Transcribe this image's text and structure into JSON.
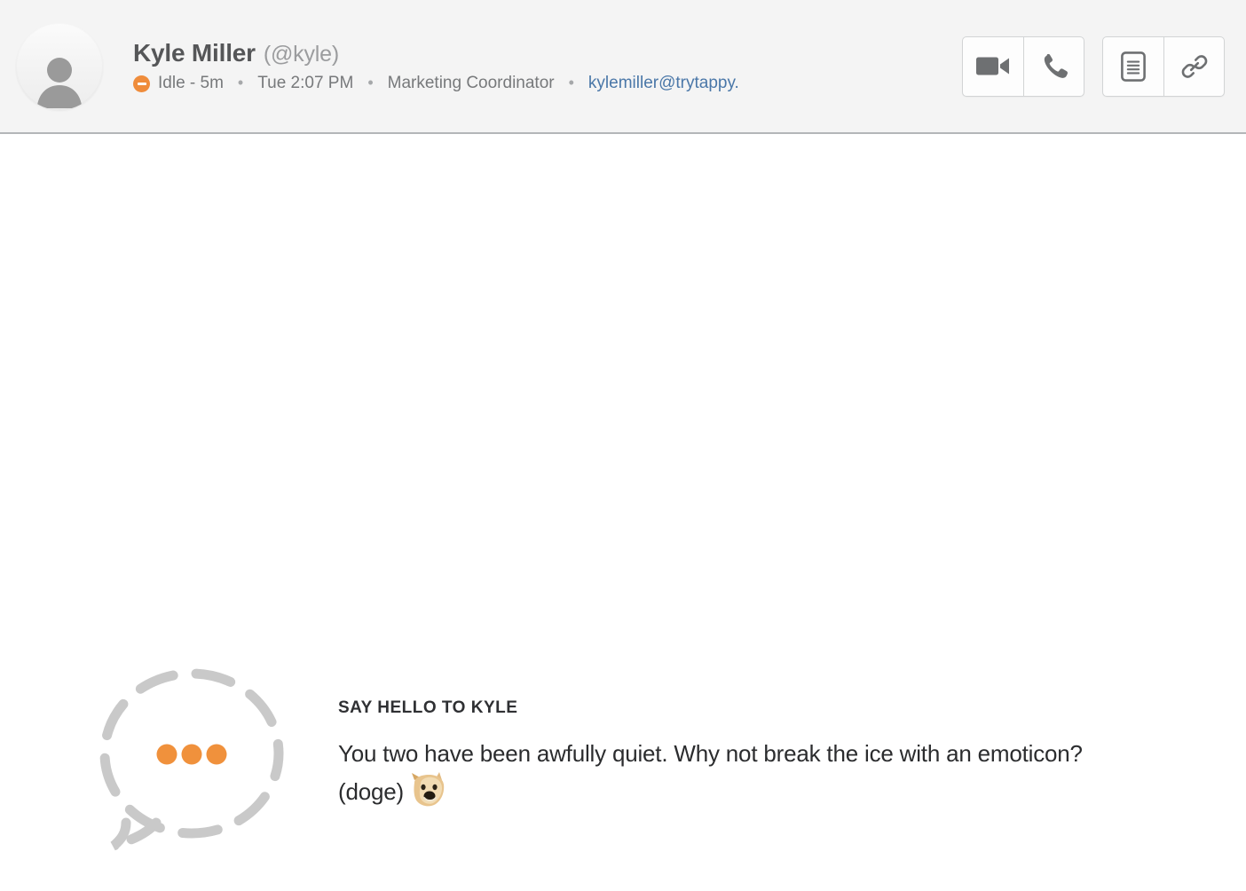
{
  "header": {
    "avatar": {
      "icon": "person-placeholder-icon",
      "alt": "Default user avatar"
    },
    "display_name": "Kyle Miller",
    "handle": "(@kyle)",
    "status": {
      "icon": "idle-status-icon",
      "text": "Idle - 5m",
      "color": "#EF8C3B"
    },
    "separator": "•",
    "local_time": "Tue 2:07 PM",
    "job_title": "Marketing Coordinator",
    "email": "kylemiller@trytappy.",
    "email_color": "#4A77A8",
    "actions": [
      {
        "name": "video-call-button",
        "icon": "video-camera-icon",
        "label": "Video call"
      },
      {
        "name": "voice-call-button",
        "icon": "phone-icon",
        "label": "Call"
      },
      {
        "name": "notes-button",
        "icon": "document-icon",
        "label": "Notes"
      },
      {
        "name": "link-button",
        "icon": "link-icon",
        "label": "Copy link"
      }
    ]
  },
  "conversation": {
    "empty_state": {
      "bubble_icon": "speech-bubble-typing-icon",
      "bubble_stroke_color": "#C9C9C9",
      "dot_color": "#F0913C",
      "dots": 3,
      "title": "SAY HELLO TO KYLE",
      "body_before": "You two have been awfully quiet. Why not break the ice with an emoticon? (doge)",
      "emoticon_name": "doge-emoticon",
      "emoticon_code": "(doge)"
    }
  }
}
